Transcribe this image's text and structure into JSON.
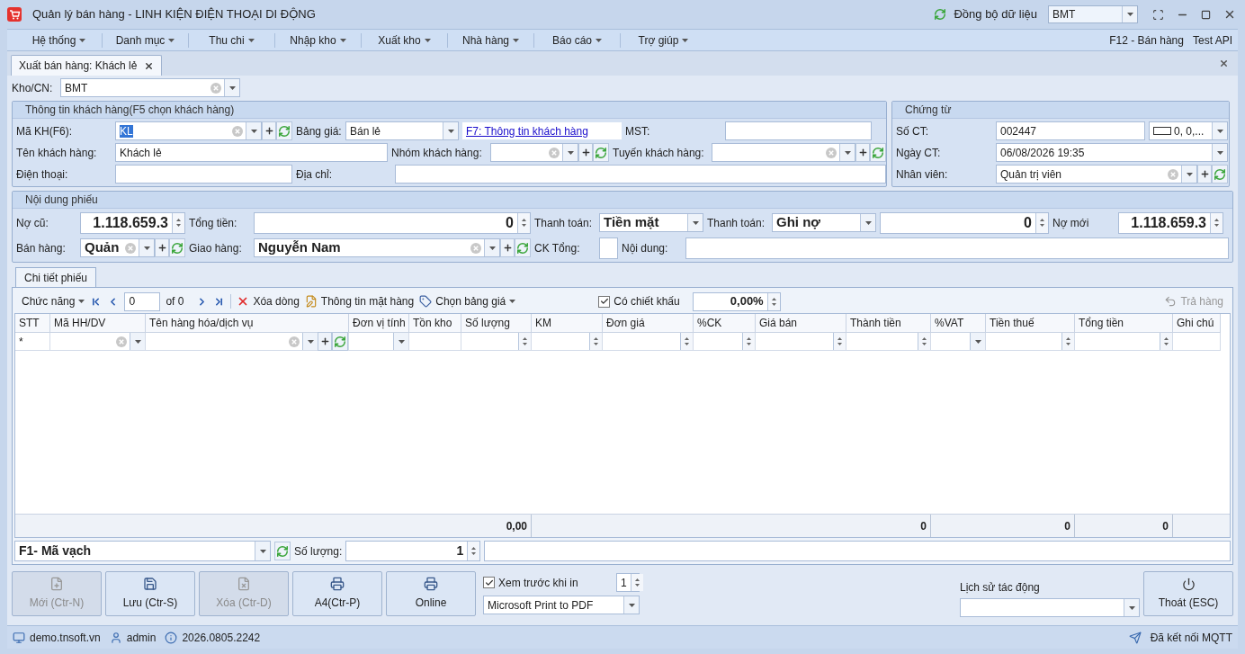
{
  "window": {
    "title": "Quản lý bán hàng - LINH KIỆN ĐIỆN THOẠI DI ĐỘNG",
    "sync_label": "Đồng bộ dữ liệu",
    "branch": "BMT"
  },
  "menu": [
    {
      "label": "Hệ thống"
    },
    {
      "label": "Danh mục"
    },
    {
      "label": "Thu chi"
    },
    {
      "label": "Nhập kho"
    },
    {
      "label": "Xuất kho"
    },
    {
      "label": "Nhà hàng"
    },
    {
      "label": "Báo cáo"
    },
    {
      "label": "Trợ giúp"
    }
  ],
  "menu_right": [
    "F12 - Bán hàng",
    "Test API"
  ],
  "doc_tabs": [
    {
      "label": "Xuất bán hàng: Khách lẻ",
      "selected": true
    }
  ],
  "warehouse": {
    "label": "Kho/CN:",
    "value": "BMT"
  },
  "customer": {
    "title": "Thông tin khách hàng(F5 chọn khách hàng)",
    "code": {
      "label": "Mã KH(F6):",
      "value": "KL",
      "text_selected": true
    },
    "price_list": {
      "label": "Bảng giá:",
      "value": "Bán lẻ"
    },
    "info_link": "F7: Thông tin khách hàng",
    "tax_code": {
      "label": "MST:"
    },
    "name": {
      "label": "Tên khách hàng:",
      "value": "Khách lẻ"
    },
    "group": {
      "label": "Nhóm khách hàng:"
    },
    "route": {
      "label": "Tuyến khách hàng:"
    },
    "phone": {
      "label": "Điện thoại:"
    },
    "address": {
      "label": "Địa chỉ:"
    }
  },
  "voucher": {
    "title": "Chứng từ",
    "number": {
      "label": "Số CT:",
      "value": "002447"
    },
    "format": "0, 0,...",
    "date": {
      "label": "Ngày CT:",
      "value": "06/08/2026 19:35"
    },
    "staff": {
      "label": "Nhân viên:",
      "value": "Quản trị viên"
    }
  },
  "content": {
    "title": "Nội dung phiếu",
    "old_debt": {
      "label": "Nợ cũ:",
      "value": "1.118.659.3"
    },
    "total": {
      "label": "Tổng tiền:",
      "value": "0"
    },
    "payment": {
      "label": "Thanh toán:",
      "value": "Tiền mặt"
    },
    "payment2": {
      "label": "Thanh toán:",
      "value": "Ghi nợ"
    },
    "paid": "0",
    "new_debt": {
      "label": "Nợ mới",
      "value": "1.118.659.3"
    },
    "seller": {
      "label": "Bán hàng:",
      "value": "Quản"
    },
    "delivery": {
      "label": "Giao hàng:",
      "value": "Nguyễn Nam"
    },
    "discount_total": {
      "label": "CK Tổng:"
    },
    "note": {
      "label": "Nội dung:"
    }
  },
  "detail_tabs": [
    {
      "label": "Chi tiết phiếu",
      "selected": true
    }
  ],
  "toolbar": {
    "functions": "Chức năng",
    "page": "0",
    "page_count": "of 0",
    "delete_row": "Xóa dòng",
    "item_info": "Thông tin mặt hàng",
    "price_list": "Chọn bảng giá",
    "discount": {
      "label": "Có chiết khấu",
      "checked": true
    },
    "discount_value": "0,00%",
    "return": {
      "label": "Trả hàng",
      "disabled": true
    }
  },
  "grid": {
    "new_row_marker": "*",
    "columns": [
      {
        "label": "STT",
        "kind": "marker"
      },
      {
        "label": "Mã HH/DV",
        "kind": "combo"
      },
      {
        "label": "Tên hàng hóa/dịch vụ",
        "kind": "combo_add"
      },
      {
        "label": "Đơn vị tính",
        "kind": "dropdown"
      },
      {
        "label": "Tồn kho",
        "kind": "plain"
      },
      {
        "label": "Số lượng",
        "kind": "spin",
        "total": "0,00"
      },
      {
        "label": "KM",
        "kind": "spin"
      },
      {
        "label": "Đơn giá",
        "kind": "spin"
      },
      {
        "label": "%CK",
        "kind": "spin"
      },
      {
        "label": "Giá bán",
        "kind": "spin"
      },
      {
        "label": "Thành tiền",
        "kind": "spin",
        "total": "0"
      },
      {
        "label": "%VAT",
        "kind": "dropdown"
      },
      {
        "label": "Tiền thuế",
        "kind": "spin",
        "total": "0"
      },
      {
        "label": "Tổng tiền",
        "kind": "spin",
        "total": "0"
      },
      {
        "label": "Ghi chú",
        "kind": "plain"
      }
    ]
  },
  "barcode": {
    "mode": "F1- Mã vạch",
    "qty_label": "Số lượng:",
    "qty": "1"
  },
  "actions": [
    {
      "label": "Mới (Ctr-N)",
      "kind": "new",
      "disabled": true
    },
    {
      "label": "Lưu (Ctr-S)",
      "kind": "save",
      "disabled": false
    },
    {
      "label": "Xóa (Ctr-D)",
      "kind": "delete",
      "disabled": true
    },
    {
      "label": "A4(Ctr-P)",
      "kind": "print",
      "disabled": false
    },
    {
      "label": "Online",
      "kind": "print",
      "disabled": false
    }
  ],
  "print": {
    "preview": {
      "label": "Xem trước khi in",
      "checked": true
    },
    "copies": "1",
    "printer": "Microsoft Print to PDF"
  },
  "history": {
    "label": "Lịch sử tác động"
  },
  "exit": "Thoát (ESC)",
  "status_bar": {
    "items": [
      {
        "kind": "site",
        "text": "demo.tnsoft.vn"
      },
      {
        "kind": "user",
        "text": "admin"
      },
      {
        "kind": "version",
        "text": "2026.0805.2242"
      }
    ],
    "connection": "Đã kết nối MQTT"
  }
}
